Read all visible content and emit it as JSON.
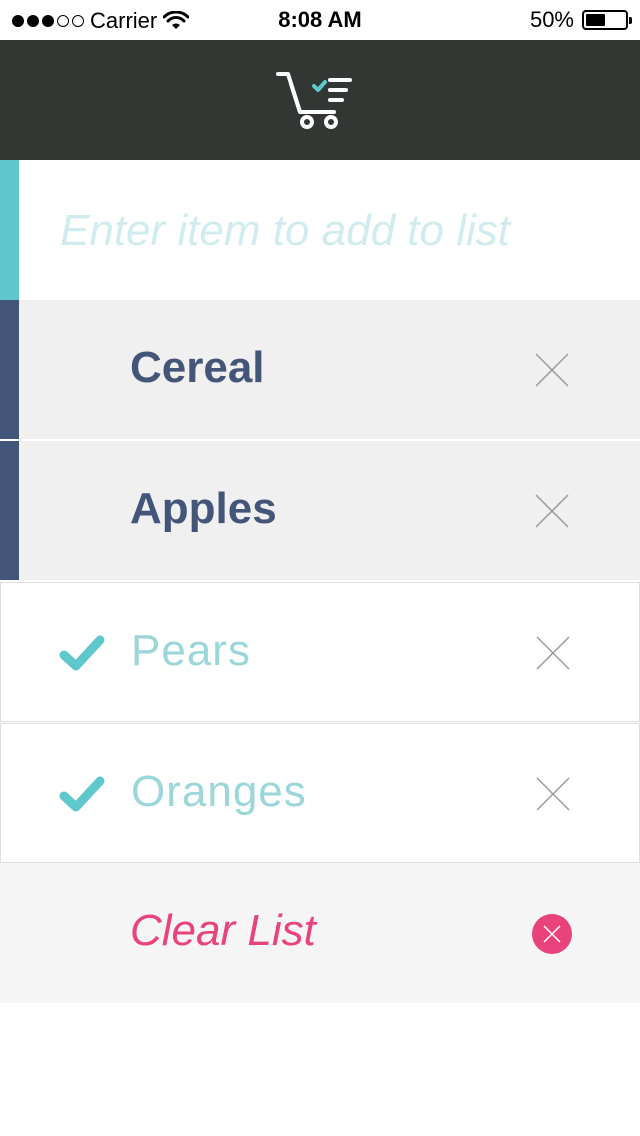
{
  "status_bar": {
    "carrier": "Carrier",
    "time": "8:08 AM",
    "battery_text": "50%",
    "battery_level": 0.5,
    "signal_bars": 3,
    "signal_total": 5
  },
  "header": {
    "logo_icon": "shopping-cart-checklist-icon"
  },
  "input": {
    "placeholder": "Enter item to add to list",
    "value": ""
  },
  "items": [
    {
      "label": "Cereal",
      "checked": false
    },
    {
      "label": "Apples",
      "checked": false
    },
    {
      "label": "Pears",
      "checked": true
    },
    {
      "label": "Oranges",
      "checked": true
    }
  ],
  "clear": {
    "label": "Clear List"
  },
  "colors": {
    "header_bg": "#323734",
    "input_accent": "#5fc8cd",
    "active_accent": "#44557a",
    "active_text": "#44557a",
    "done_text": "#9bd6d9",
    "check": "#5fc8cd",
    "clear": "#e8437c",
    "remove_x": "#9a9a9a"
  }
}
